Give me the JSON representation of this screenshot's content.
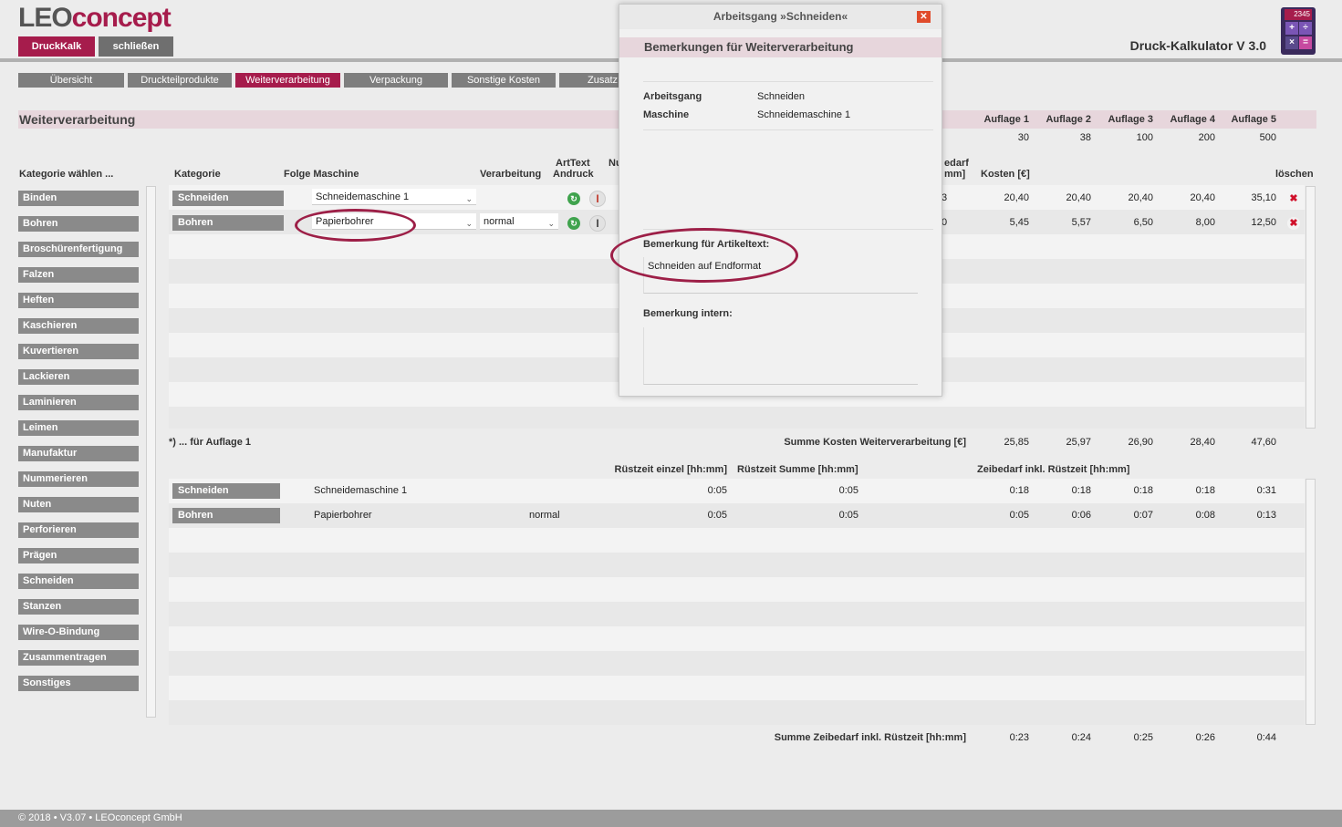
{
  "app": {
    "logo_a": "LEO",
    "logo_b": "concept",
    "title": "Druck-Kalkulator V 3.0",
    "calc_display": "2345",
    "btn_druckkalk": "DruckKalk",
    "btn_close": "schließen"
  },
  "colors": {
    "accent": "#a61c4c",
    "tab": "#7e7e7e",
    "section": "#e7d6dc"
  },
  "tabs": [
    "Übersicht",
    "Druckteilprodukte",
    "Weiterverarbeitung",
    "Verpackung",
    "Sonstige Kosten",
    "Zusatz"
  ],
  "active_tab": "Weiterverarbeitung",
  "section_title": "Weiterverarbeitung",
  "auflagen": {
    "labels": [
      "Auflage 1",
      "Auflage 2",
      "Auflage 3",
      "Auflage 4",
      "Auflage 5"
    ],
    "values": [
      "30",
      "38",
      "100",
      "200",
      "500"
    ]
  },
  "sidebar": {
    "heading": "Kategorie wählen ...",
    "items": [
      "Binden",
      "Bohren",
      "Broschürenfertigung",
      "Falzen",
      "Heften",
      "Kaschieren",
      "Kuvertieren",
      "Lackieren",
      "Laminieren",
      "Leimen",
      "Manufaktur",
      "Nummerieren",
      "Nuten",
      "Perforieren",
      "Prägen",
      "Schneiden",
      "Stanzen",
      "Wire-O-Bindung",
      "Zusammentragen",
      "Sonstiges"
    ]
  },
  "table": {
    "h_kategorie": "Kategorie",
    "h_folge": "Folge Maschine",
    "h_verarbeitung": "Verarbeitung",
    "h_arttext_1": "ArtText",
    "h_arttext_2": "Andruck",
    "h_nu": "Nu",
    "h_bedarf_1": "edarf",
    "h_bedarf_2": "mm]",
    "h_kosten": "Kosten [€]",
    "h_loeschen": "löschen",
    "rows": [
      {
        "kategorie": "Schneiden",
        "maschine": "Schneidemaschine 1",
        "verarbeitung": "",
        "bedarf": "3",
        "kosten": [
          "20,40",
          "20,40",
          "20,40",
          "20,40",
          "35,10"
        ]
      },
      {
        "kategorie": "Bohren",
        "maschine": "Papierbohrer",
        "verarbeitung": "normal",
        "bedarf": "0",
        "kosten": [
          "5,45",
          "5,57",
          "6,50",
          "8,00",
          "12,50"
        ]
      }
    ],
    "footnote": "*) ... für Auflage 1",
    "summe_label": "Summe Kosten Weiterverarbeitung [€]",
    "summe": [
      "25,85",
      "25,97",
      "26,90",
      "28,40",
      "47,60"
    ]
  },
  "times": {
    "h_einzel": "Rüstzeit einzel [hh:mm]",
    "h_summe": "Rüstzeit Summe [hh:mm]",
    "h_zeibedarf": "Zeibedarf inkl. Rüstzeit [hh:mm]",
    "rows": [
      {
        "kategorie": "Schneiden",
        "maschine": "Schneidemaschine 1",
        "verarbeitung": "",
        "einzel": "0:05",
        "summe": "0:05",
        "werte": [
          "0:18",
          "0:18",
          "0:18",
          "0:18",
          "0:31"
        ]
      },
      {
        "kategorie": "Bohren",
        "maschine": "Papierbohrer",
        "verarbeitung": "normal",
        "einzel": "0:05",
        "summe": "0:05",
        "werte": [
          "0:05",
          "0:06",
          "0:07",
          "0:08",
          "0:13"
        ]
      }
    ],
    "summe_label": "Summe Zeibedarf inkl. Rüstzeit [hh:mm]",
    "summe": [
      "0:23",
      "0:24",
      "0:25",
      "0:26",
      "0:44"
    ]
  },
  "modal": {
    "title": "Arbeitsgang »Schneiden«",
    "subtitle": "Bemerkungen für Weiterverarbeitung",
    "k_arbeitsgang": "Arbeitsgang",
    "v_arbeitsgang": "Schneiden",
    "k_maschine": "Maschine",
    "v_maschine": "Schneidemaschine 1",
    "artikeltext_label": "Bemerkung für Artikeltext:",
    "artikeltext_value": "Schneiden auf Endformat",
    "intern_label": "Bemerkung intern:",
    "intern_value": ""
  },
  "footer": "© 2018 • V3.07 • LEOconcept GmbH"
}
